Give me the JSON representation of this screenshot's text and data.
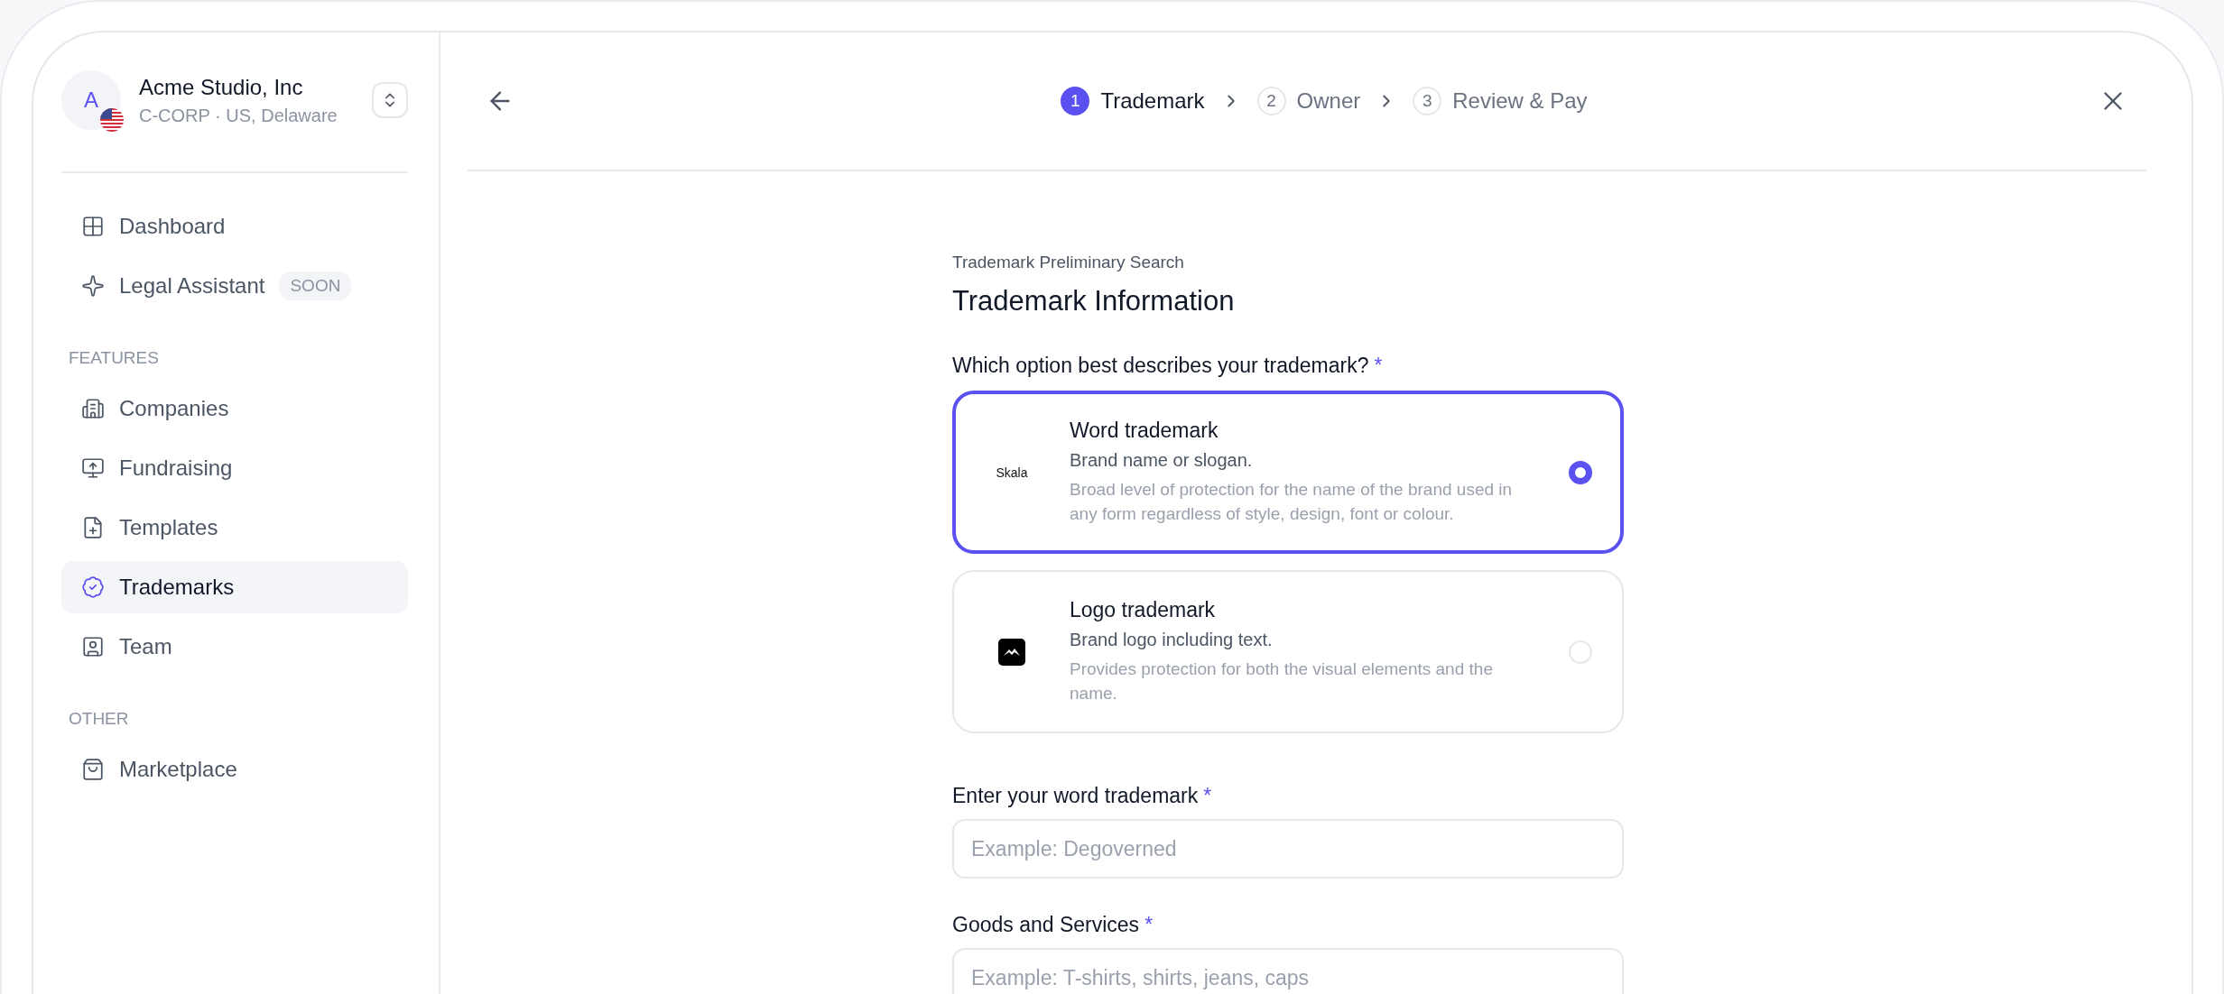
{
  "sidebar": {
    "company": {
      "initial": "A",
      "name": "Acme Studio, Inc",
      "meta": "C-CORP · US, Delaware"
    },
    "sections": [
      {
        "items": [
          {
            "kind": "grid",
            "label": "Dashboard",
            "selected": false
          },
          {
            "kind": "sparkle",
            "label": "Legal Assistant",
            "badge": "SOON",
            "selected": false
          }
        ]
      },
      {
        "heading": "FEATURES",
        "items": [
          {
            "kind": "building",
            "label": "Companies",
            "selected": false
          },
          {
            "kind": "upload",
            "label": "Fundraising",
            "selected": false
          },
          {
            "kind": "file",
            "label": "Templates",
            "selected": false
          },
          {
            "kind": "badge",
            "label": "Trademarks",
            "selected": true
          },
          {
            "kind": "user",
            "label": "Team",
            "selected": false
          }
        ]
      },
      {
        "heading": "OTHER",
        "items": [
          {
            "kind": "bag",
            "label": "Marketplace",
            "selected": false
          }
        ]
      }
    ]
  },
  "stepper": {
    "steps": [
      {
        "number": "1",
        "label": "Trademark",
        "selected": true
      },
      {
        "number": "2",
        "label": "Owner",
        "selected": false
      },
      {
        "number": "3",
        "label": "Review & Pay",
        "selected": false
      }
    ]
  },
  "form": {
    "eyebrow": "Trademark Preliminary Search",
    "title": "Trademark Information",
    "question": {
      "label": "Which option best describes your trademark?",
      "required_mark": "*"
    },
    "options": [
      {
        "kind": "word",
        "logo_text": "Skala",
        "title": "Word trademark",
        "subtitle": "Brand name or slogan.",
        "description": "Broad level of protection for the name of the brand used in any form regardless of style, design, font or colour.",
        "selected": true
      },
      {
        "kind": "logo",
        "title": "Logo trademark",
        "subtitle": "Brand logo including text.",
        "description": "Provides protection for both the visual elements and the name.",
        "selected": false
      }
    ],
    "fields": [
      {
        "label": "Enter your word trademark",
        "required_mark": "*",
        "placeholder": "Example: Degoverned"
      },
      {
        "label": "Goods and Services",
        "required_mark": "*",
        "placeholder": "Example: T-shirts, shirts, jeans, caps"
      }
    ]
  }
}
